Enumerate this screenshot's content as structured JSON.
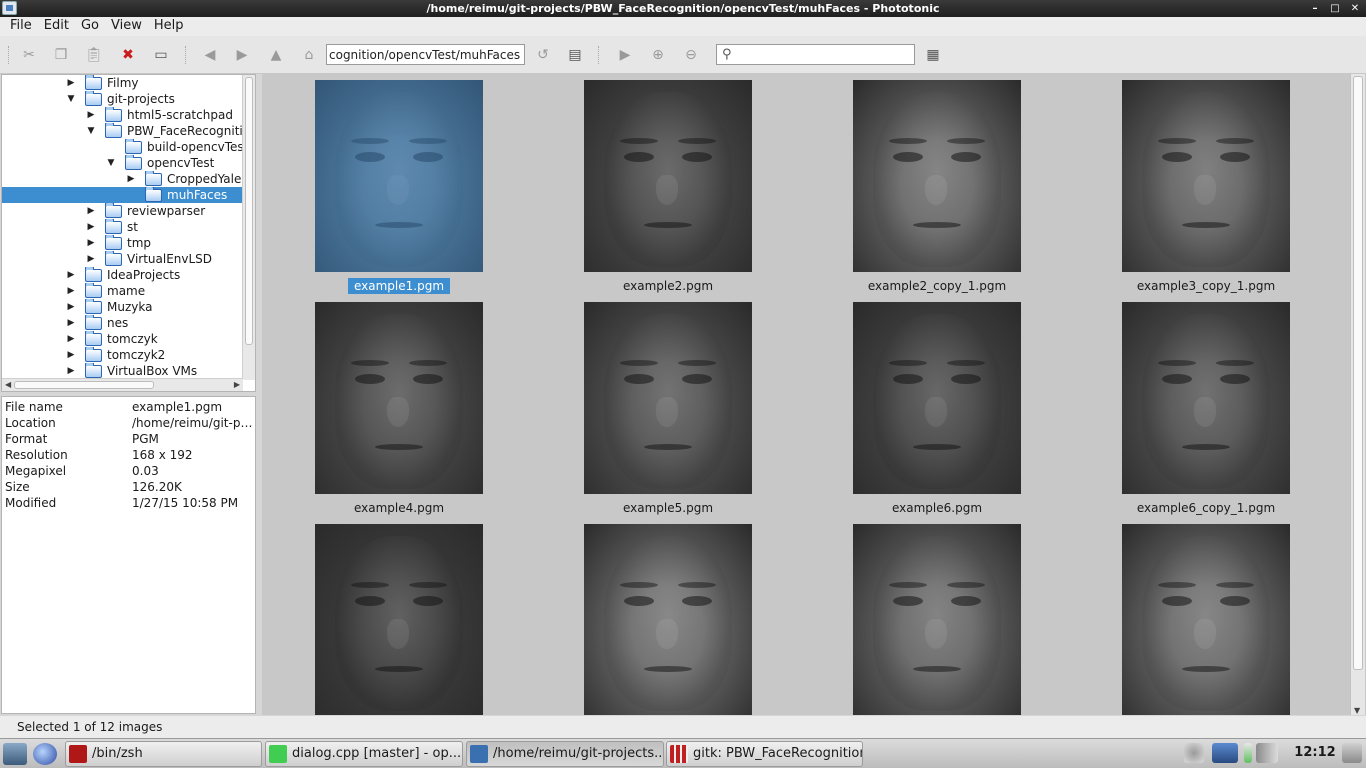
{
  "window": {
    "title": "/home/reimu/git-projects/PBW_FaceRecognition/opencvTest/muhFaces - Phototonic"
  },
  "menu": {
    "items": [
      "File",
      "Edit",
      "Go",
      "View",
      "Help"
    ]
  },
  "toolbar": {
    "path_value": "cognition/opencvTest/muhFaces",
    "search_value": "",
    "icons": [
      "cut-icon",
      "copy-icon",
      "paste-icon",
      "delete-icon",
      "rename-icon",
      "back-icon",
      "forward-icon",
      "up-icon",
      "home-icon",
      "refresh-icon",
      "thumbnail-view-icon",
      "slideshow-icon",
      "zoom-in-icon",
      "zoom-out-icon",
      "search-icon",
      "settings-icon"
    ]
  },
  "tree": {
    "items": [
      {
        "label": "Filmy",
        "arrow": "▶"
      },
      {
        "label": "git-projects",
        "arrow": "▼"
      },
      {
        "label": "html5-scratchpad",
        "arrow": "▶"
      },
      {
        "label": "PBW_FaceRecognition",
        "arrow": "▼"
      },
      {
        "label": "build-opencvTest",
        "arrow": ""
      },
      {
        "label": "opencvTest",
        "arrow": "▼"
      },
      {
        "label": "CroppedYale",
        "arrow": "▶"
      },
      {
        "label": "muhFaces",
        "arrow": ""
      },
      {
        "label": "reviewparser",
        "arrow": "▶"
      },
      {
        "label": "st",
        "arrow": "▶"
      },
      {
        "label": "tmp",
        "arrow": "▶"
      },
      {
        "label": "VirtualEnvLSD",
        "arrow": "▶"
      },
      {
        "label": "IdeaProjects",
        "arrow": "▶"
      },
      {
        "label": "mame",
        "arrow": "▶"
      },
      {
        "label": "Muzyka",
        "arrow": "▶"
      },
      {
        "label": "nes",
        "arrow": "▶"
      },
      {
        "label": "tomczyk",
        "arrow": "▶"
      },
      {
        "label": "tomczyk2",
        "arrow": "▶"
      },
      {
        "label": "VirtualBox VMs",
        "arrow": "▶"
      }
    ]
  },
  "info": {
    "rows": [
      {
        "key": "File name",
        "value": "example1.pgm"
      },
      {
        "key": "Location",
        "value": "/home/reimu/git-projects/PBW_FaceRecognition/opencvTest/muhFaces"
      },
      {
        "key": "Format",
        "value": "PGM"
      },
      {
        "key": "Resolution",
        "value": "168 x 192"
      },
      {
        "key": "Megapixel",
        "value": "0.03"
      },
      {
        "key": "Size",
        "value": "126.20K"
      },
      {
        "key": "Modified",
        "value": "1/27/15 10:58 PM"
      }
    ]
  },
  "thumbnails": [
    {
      "name": "example1.pgm",
      "tone": "#5f6e78",
      "selected": true
    },
    {
      "name": "example2.pgm",
      "tone": "#4a4a4a",
      "selected": false
    },
    {
      "name": "example2_copy_1.pgm",
      "tone": "#6a6a6a",
      "selected": false
    },
    {
      "name": "example3_copy_1.pgm",
      "tone": "#646464",
      "selected": false
    },
    {
      "name": "example4.pgm",
      "tone": "#4c4c4c",
      "selected": false
    },
    {
      "name": "example5.pgm",
      "tone": "#545454",
      "selected": false
    },
    {
      "name": "example6.pgm",
      "tone": "#464646",
      "selected": false
    },
    {
      "name": "example6_copy_1.pgm",
      "tone": "#525252",
      "selected": false
    },
    {
      "name": "",
      "tone": "#3e3e3e",
      "selected": false
    },
    {
      "name": "",
      "tone": "#6e6e6e",
      "selected": false
    },
    {
      "name": "",
      "tone": "#686868",
      "selected": false
    },
    {
      "name": "",
      "tone": "#6c6c6c",
      "selected": false
    }
  ],
  "status": {
    "text": "Selected 1 of 12 images"
  },
  "taskbar": {
    "tasks": [
      {
        "label": "/bin/zsh",
        "icon_color": "#b01818",
        "active": false
      },
      {
        "label": "dialog.cpp [master] - op...",
        "icon_color": "#41cd52",
        "active": false
      },
      {
        "label": "/home/reimu/git-projects...",
        "icon_color": "#3a6fb0",
        "active": true
      },
      {
        "label": "gitk: PBW_FaceRecognition",
        "icon_color": "#c02020",
        "active": false
      }
    ],
    "clock": "12:12"
  }
}
